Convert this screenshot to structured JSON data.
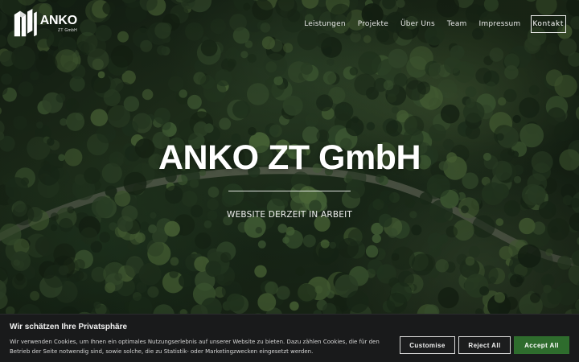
{
  "header": {
    "logo": {
      "name": "ANKO",
      "sub": "ZT GmbH"
    },
    "nav": [
      {
        "label": "Leistungen"
      },
      {
        "label": "Projekte"
      },
      {
        "label": "Über Uns"
      },
      {
        "label": "Team"
      },
      {
        "label": "Impressum"
      }
    ],
    "cta_label": "Kontakt"
  },
  "hero": {
    "title": "ANKO ZT GmbH",
    "subtitle": "WEBSITE DERZEIT IN ARBEIT",
    "background": "forest-aerial-photo"
  },
  "cookie_banner": {
    "title": "Wir schätzen Ihre Privatsphäre",
    "text": "Wir verwenden Cookies, um Ihnen ein optimales Nutzungserlebnis auf unserer Website zu bieten. Dazu zählen Cookies, die für den Betrieb der Seite notwendig sind, sowie solche, die zu Statistik- oder Marketingzwecken eingesetzt werden.",
    "buttons": {
      "customise": "Customise",
      "reject": "Reject All",
      "accept": "Accept All"
    }
  },
  "colors": {
    "accent": "#2e6c2d",
    "banner_bg": "#191a1b"
  }
}
